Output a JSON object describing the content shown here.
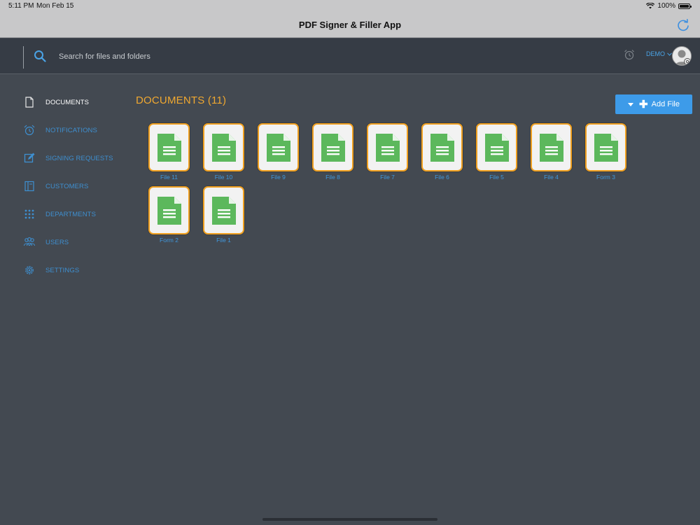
{
  "status_bar": {
    "time": "5:11 PM",
    "date": "Mon Feb 15",
    "battery": "100%"
  },
  "app": {
    "title": "PDF Signer & Filler App"
  },
  "search": {
    "placeholder": "Search for files and folders",
    "value": ""
  },
  "user": {
    "name": "DEMO"
  },
  "sidebar": {
    "items": [
      {
        "label": "DOCUMENTS",
        "icon": "document-icon",
        "active": true
      },
      {
        "label": "NOTIFICATIONS",
        "icon": "alarm-clock-icon"
      },
      {
        "label": "SIGNING REQUESTS",
        "icon": "edit-icon"
      },
      {
        "label": "CUSTOMERS",
        "icon": "contacts-book-icon"
      },
      {
        "label": "DEPARTMENTS",
        "icon": "grid-dots-icon"
      },
      {
        "label": "USERS",
        "icon": "users-icon"
      },
      {
        "label": "SETTINGS",
        "icon": "gear-icon"
      }
    ]
  },
  "main": {
    "title": "DOCUMENTS (11)",
    "add_file_label": "Add File",
    "files": [
      {
        "name": "File 11"
      },
      {
        "name": "File 10"
      },
      {
        "name": "File 9"
      },
      {
        "name": "File 8"
      },
      {
        "name": "File 7"
      },
      {
        "name": "File 6"
      },
      {
        "name": "File 5"
      },
      {
        "name": "File 4"
      },
      {
        "name": "Form 3"
      },
      {
        "name": "Form 2"
      },
      {
        "name": "File 1"
      }
    ]
  },
  "colors": {
    "accent": "#3d9be9",
    "title_orange": "#f0a830",
    "tile_border": "#f0a020",
    "doc_green": "#5cb85c",
    "background": "#434951",
    "header": "#363c45"
  }
}
